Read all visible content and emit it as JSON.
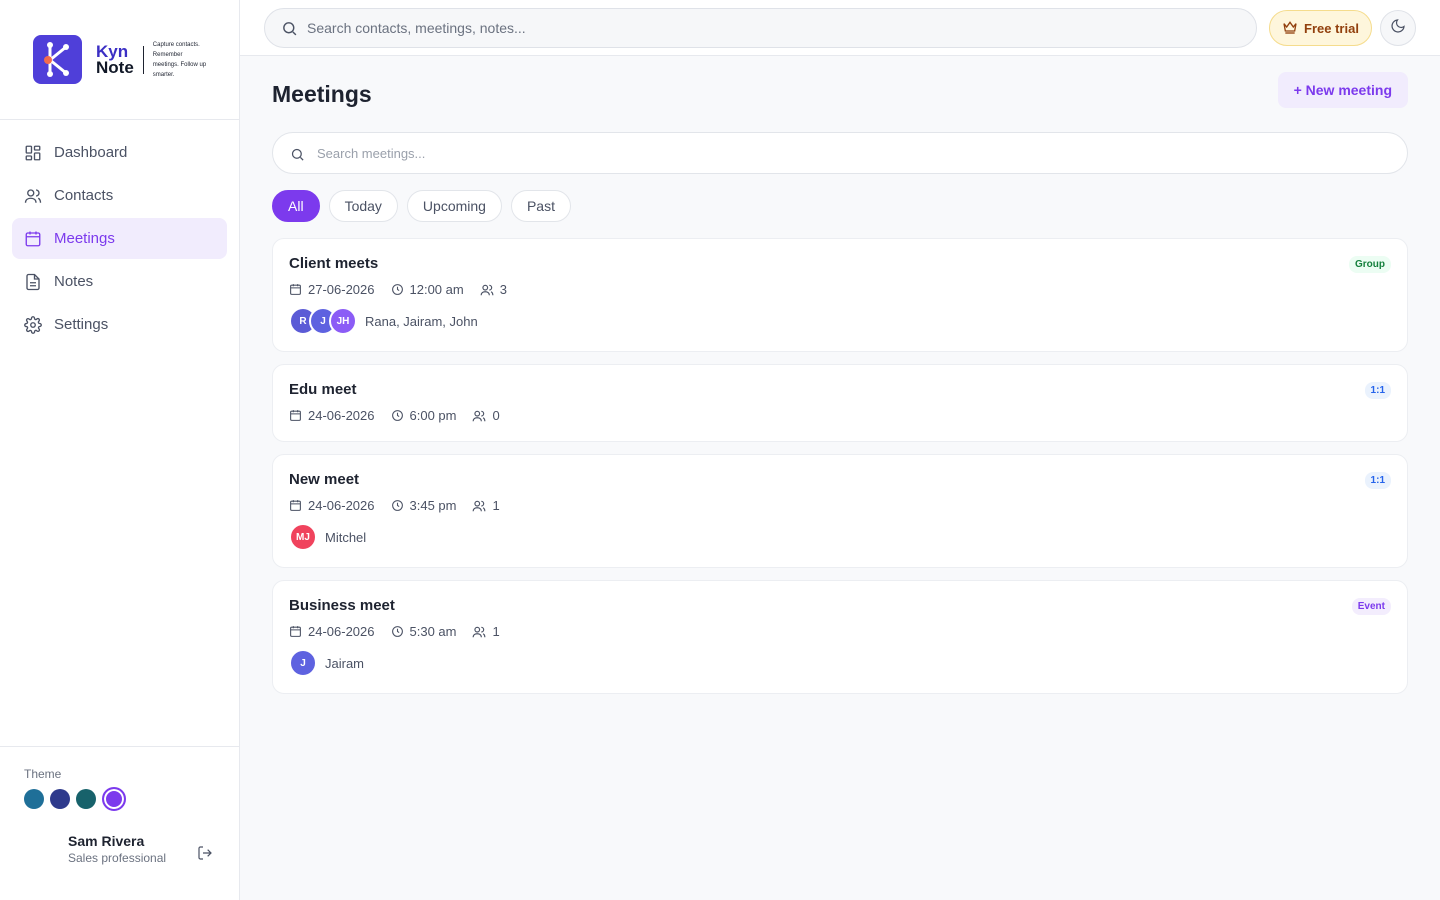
{
  "brand": {
    "name_line1": "Kyn",
    "name_line2": "Note",
    "tagline": "Capture contacts. Remember meetings. Follow up smarter.",
    "accent": "#7c3aed",
    "logo_color": "#4f3fd9"
  },
  "sidebar": {
    "items": [
      {
        "label": "Dashboard",
        "icon": "dashboard-icon"
      },
      {
        "label": "Contacts",
        "icon": "users-icon"
      },
      {
        "label": "Meetings",
        "icon": "calendar-icon",
        "active": true
      },
      {
        "label": "Notes",
        "icon": "file-text-icon"
      },
      {
        "label": "Settings",
        "icon": "gear-icon"
      }
    ],
    "theme_label": "Theme",
    "theme_swatches": [
      "#1f6f98",
      "#2e3a8c",
      "#17626b",
      "#7c3aed"
    ],
    "user": {
      "name": "Sam Rivera",
      "role": "Sales professional"
    }
  },
  "topbar": {
    "search_placeholder": "Search contacts, meetings, notes...",
    "free_trial_label": "Free trial"
  },
  "main": {
    "title": "Meetings",
    "new_button_label": "+ New meeting",
    "search_placeholder": "Search meetings...",
    "filters": [
      "All",
      "Today",
      "Upcoming",
      "Past"
    ],
    "active_filter": "All",
    "meetings": [
      {
        "title": "Client meets",
        "date": "27-06-2026",
        "time": "12:00 am",
        "attendee_count": "3",
        "badge": "Group",
        "avatars": [
          {
            "initials": "R",
            "color": "#5b5bd6"
          },
          {
            "initials": "J",
            "color": "#5e62e0"
          },
          {
            "initials": "JH",
            "color": "#8b5cf6"
          }
        ],
        "names": "Rana, Jairam, John"
      },
      {
        "title": "Edu meet",
        "date": "24-06-2026",
        "time": "6:00 pm",
        "attendee_count": "0",
        "badge": "1:1",
        "avatars": [],
        "names": ""
      },
      {
        "title": "New meet",
        "date": "24-06-2026",
        "time": "3:45 pm",
        "attendee_count": "1",
        "badge": "1:1",
        "avatars": [
          {
            "initials": "MJ",
            "color": "#f0435d"
          }
        ],
        "names": "Mitchel"
      },
      {
        "title": "Business meet",
        "date": "24-06-2026",
        "time": "5:30 am",
        "attendee_count": "1",
        "badge": "Event",
        "avatars": [
          {
            "initials": "J",
            "color": "#5e62e0"
          }
        ],
        "names": "Jairam"
      }
    ]
  }
}
